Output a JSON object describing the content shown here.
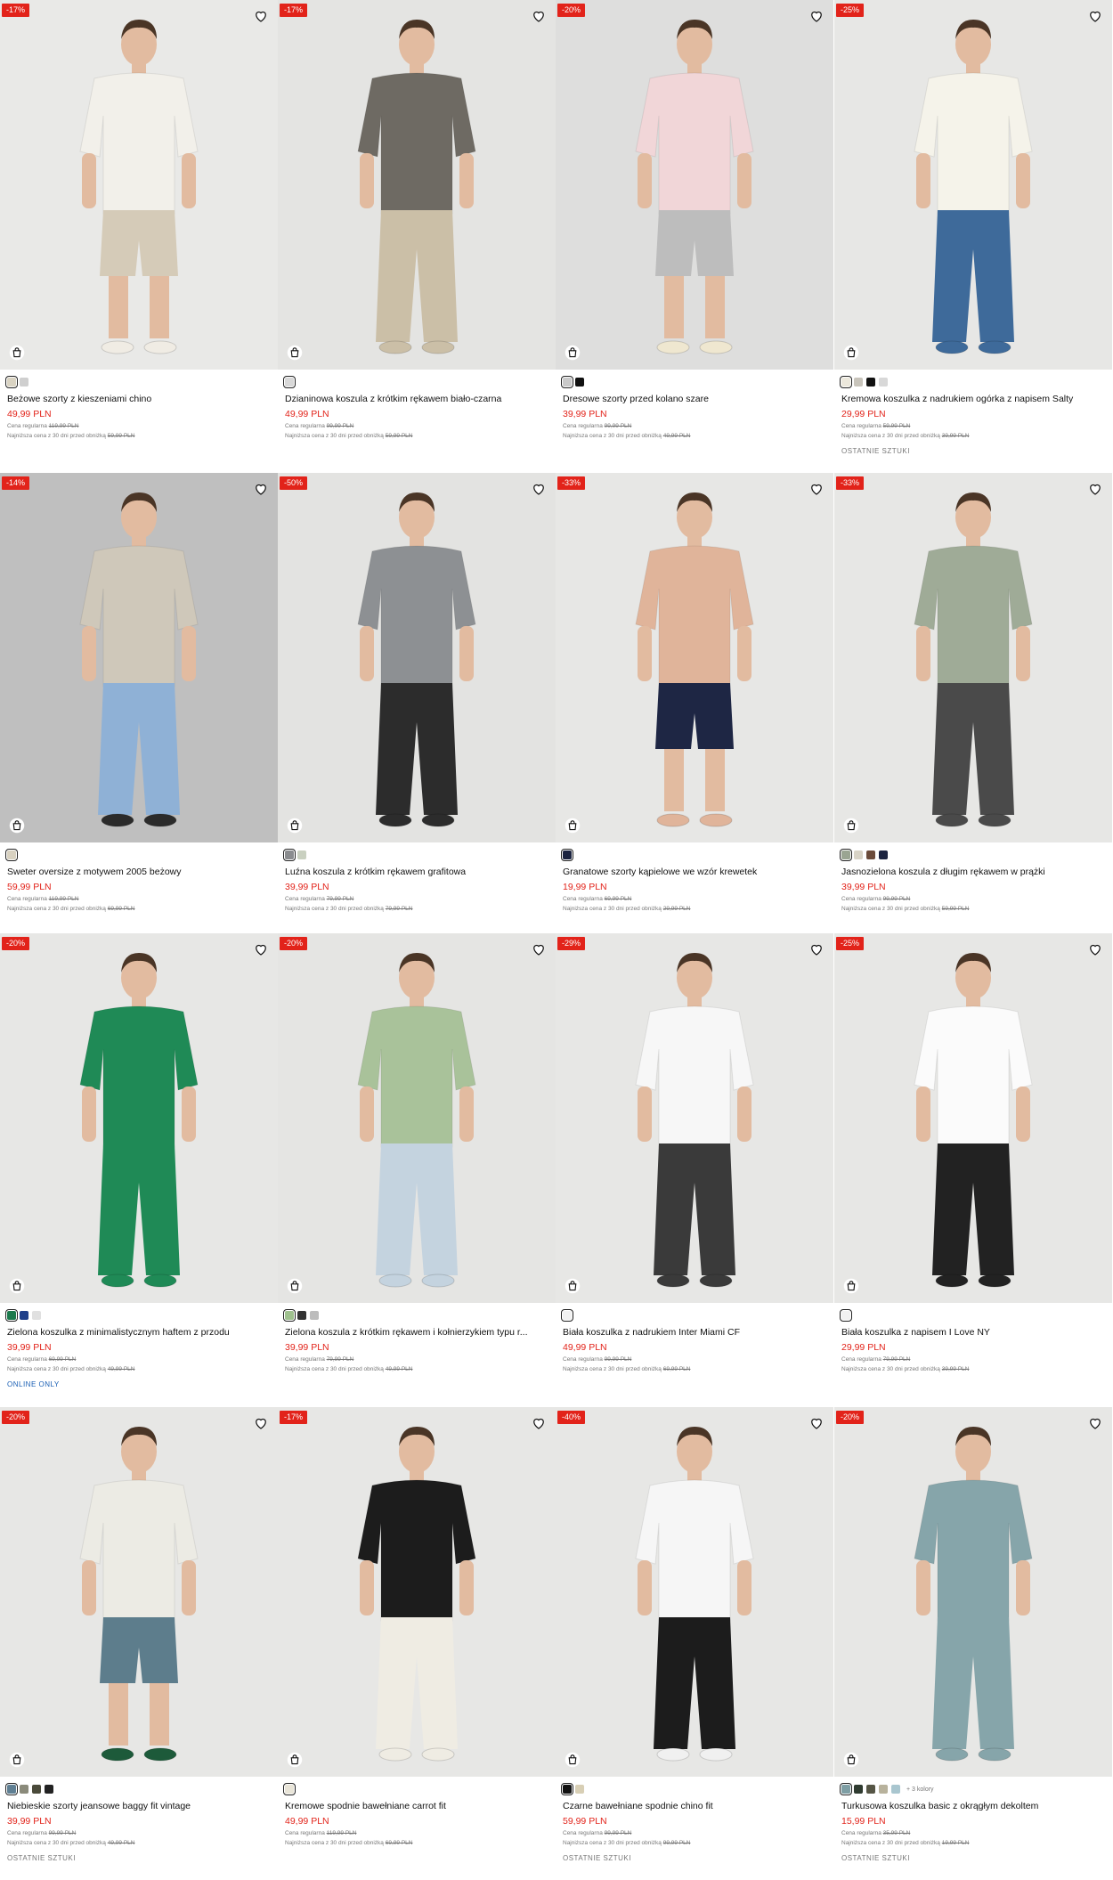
{
  "currency": "PLN",
  "regular_label": "Cena regularna",
  "lowest_label": "Najniższa cena z 30 dni przed obniżką",
  "icons": {
    "favorite": "heart-outline-icon",
    "cart": "shopping-bag-icon"
  },
  "colors": {
    "sale_red": "#e2231a",
    "online_blue": "#1a5fb4"
  },
  "products": [
    {
      "badge": "-17%",
      "name": "Beżowe szorty z kieszeniami chino",
      "price": "49,99 PLN",
      "regular": "119,99 PLN",
      "lowest": "59,99 PLN",
      "tag": "",
      "swatches": [
        "#d9d3c2",
        "#cfcfcf"
      ],
      "more": "",
      "bg": "#e9e9e7",
      "shirt": "#f2f0ea",
      "pants": "#d5cbb8",
      "pants_len": "short",
      "shoes": "#f0ece4"
    },
    {
      "badge": "-17%",
      "name": "Dzianinowa koszula z krótkim rękawem biało-czarna",
      "price": "49,99 PLN",
      "regular": "99,99 PLN",
      "lowest": "59,99 PLN",
      "tag": "",
      "swatches": [
        "#d8d8d8"
      ],
      "more": "",
      "bg": "#e4e4e2",
      "shirt": "#6e6a63",
      "pants": "#cbbfa7",
      "pants_len": "long",
      "shoes": "#cbbfa7"
    },
    {
      "badge": "-20%",
      "name": "Dresowe szorty przed kolano szare",
      "price": "39,99 PLN",
      "regular": "99,99 PLN",
      "lowest": "49,99 PLN",
      "tag": "",
      "swatches": [
        "#c9c9c9",
        "#111111"
      ],
      "more": "",
      "bg": "#dededd",
      "shirt": "#f1d6d8",
      "pants": "#bdbdbd",
      "pants_len": "short",
      "shoes": "#efe7d0"
    },
    {
      "badge": "-25%",
      "name": "Kremowa koszulka z nadrukiem ogórka z napisem Salty",
      "price": "29,99 PLN",
      "regular": "59,99 PLN",
      "lowest": "39,99 PLN",
      "tag": "OSTATNIE SZTUKI",
      "swatches": [
        "#ece8dc",
        "#c8c4bb",
        "#111111",
        "#d8d8d8"
      ],
      "more": "",
      "bg": "#e7e7e5",
      "shirt": "#f5f3ea",
      "pants": "#3e6a9a",
      "pants_len": "long",
      "shoes": "#3e6a9a"
    },
    {
      "badge": "-14%",
      "name": "Sweter oversize z motywem 2005 beżowy",
      "price": "59,99 PLN",
      "regular": "119,99 PLN",
      "lowest": "69,99 PLN",
      "tag": "",
      "swatches": [
        "#d8d1c0"
      ],
      "more": "",
      "bg": "#bfbfbf",
      "shirt": "#cfc8ba",
      "pants": "#8fb1d6",
      "pants_len": "long",
      "shoes": "#2b2b2b"
    },
    {
      "badge": "-50%",
      "name": "Luźna koszula z krótkim rękawem grafitowa",
      "price": "39,99 PLN",
      "regular": "79,99 PLN",
      "lowest": "79,99 PLN",
      "tag": "",
      "swatches": [
        "#8a8c8f",
        "#c9d0c0"
      ],
      "more": "",
      "bg": "#e3e3e1",
      "shirt": "#8d9093",
      "pants": "#2c2c2c",
      "pants_len": "long",
      "shoes": "#2c2c2c"
    },
    {
      "badge": "-33%",
      "name": "Granatowe szorty kąpielowe we wzór krewetek",
      "price": "19,99 PLN",
      "regular": "69,99 PLN",
      "lowest": "29,99 PLN",
      "tag": "",
      "swatches": [
        "#1b2340"
      ],
      "more": "",
      "bg": "#e7e7e5",
      "shirt": "#e0b49a",
      "pants": "#1e2644",
      "pants_len": "short",
      "shoes": "#e0b49a"
    },
    {
      "badge": "-33%",
      "name": "Jasnozielona koszula z długim rękawem w prążki",
      "price": "39,99 PLN",
      "regular": "99,99 PLN",
      "lowest": "59,99 PLN",
      "tag": "",
      "swatches": [
        "#9aa592",
        "#d8d3c6",
        "#6b4b3a",
        "#1b2340"
      ],
      "more": "",
      "bg": "#e7e7e5",
      "shirt": "#9fab97",
      "pants": "#4a4a4a",
      "pants_len": "long",
      "shoes": "#4a4a4a"
    },
    {
      "badge": "-20%",
      "name": "Zielona koszulka z minimalistycznym haftem z przodu",
      "price": "39,99 PLN",
      "regular": "69,99 PLN",
      "lowest": "49,99 PLN",
      "tag": "ONLINE ONLY",
      "swatches": [
        "#1d7a4d",
        "#1f3f8a",
        "#e0e0e0"
      ],
      "more": "",
      "bg": "#e7e7e5",
      "shirt": "#1f8a56",
      "pants": "#1f8a56",
      "pants_len": "long",
      "shoes": "#1f8a56"
    },
    {
      "badge": "-20%",
      "name": "Zielona koszula z krótkim rękawem i kołnierzykiem typu r...",
      "price": "39,99 PLN",
      "regular": "79,99 PLN",
      "lowest": "49,99 PLN",
      "tag": "",
      "swatches": [
        "#9fc18e",
        "#333333",
        "#bcbcbc"
      ],
      "more": "",
      "bg": "#e5e5e3",
      "shirt": "#a9c29a",
      "pants": "#c4d3df",
      "pants_len": "long",
      "shoes": "#c4d3df"
    },
    {
      "badge": "-29%",
      "name": "Biała koszulka z nadrukiem Inter Miami CF",
      "price": "49,99 PLN",
      "regular": "99,99 PLN",
      "lowest": "69,99 PLN",
      "tag": "",
      "swatches": [
        "#f2f2f2"
      ],
      "more": "",
      "bg": "#e7e7e5",
      "shirt": "#f7f7f7",
      "pants": "#3a3a3a",
      "pants_len": "long",
      "shoes": "#3a3a3a"
    },
    {
      "badge": "-25%",
      "name": "Biała koszulka z napisem I Love NY",
      "price": "29,99 PLN",
      "regular": "79,99 PLN",
      "lowest": "39,99 PLN",
      "tag": "",
      "swatches": [
        "#f2f2f2"
      ],
      "more": "",
      "bg": "#e7e7e5",
      "shirt": "#fbfbfb",
      "pants": "#222222",
      "pants_len": "long",
      "shoes": "#222222"
    },
    {
      "badge": "-20%",
      "name": "Niebieskie szorty jeansowe baggy fit vintage",
      "price": "39,99 PLN",
      "regular": "99,99 PLN",
      "lowest": "49,99 PLN",
      "tag": "OSTATNIE SZTUKI",
      "swatches": [
        "#5f7f93",
        "#8a8a7a",
        "#4a4a3a",
        "#222222"
      ],
      "more": "",
      "bg": "#e7e7e5",
      "shirt": "#ecebe4",
      "pants": "#5d7d8c",
      "pants_len": "short",
      "shoes": "#1d5a3a"
    },
    {
      "badge": "-17%",
      "name": "Kremowe spodnie bawełniane carrot fit",
      "price": "49,99 PLN",
      "regular": "119,99 PLN",
      "lowest": "69,99 PLN",
      "tag": "",
      "swatches": [
        "#e9e5d8"
      ],
      "more": "",
      "bg": "#e7e7e5",
      "shirt": "#1c1c1c",
      "pants": "#efece3",
      "pants_len": "long",
      "shoes": "#efece3"
    },
    {
      "badge": "-40%",
      "name": "Czarne bawełniane spodnie chino fit",
      "price": "59,99 PLN",
      "regular": "99,99 PLN",
      "lowest": "99,99 PLN",
      "tag": "OSTATNIE SZTUKI",
      "swatches": [
        "#111111",
        "#d8cfb5"
      ],
      "more": "",
      "bg": "#e7e7e5",
      "shirt": "#f6f6f6",
      "pants": "#1c1c1c",
      "pants_len": "long",
      "shoes": "#f0f0f0"
    },
    {
      "badge": "-20%",
      "name": "Turkusowa koszulka basic z okrągłym dekoltem",
      "price": "15,99 PLN",
      "regular": "35,99 PLN",
      "lowest": "19,99 PLN",
      "tag": "OSTATNIE SZTUKI",
      "swatches": [
        "#7e9ea4",
        "#2f3b30",
        "#555545",
        "#b8b29c",
        "#a9c6cf"
      ],
      "more": "+ 3 kolory",
      "bg": "#e7e7e5",
      "shirt": "#86a5aa",
      "pants": "#86a5aa",
      "pants_len": "long",
      "shoes": "#86a5aa"
    }
  ]
}
